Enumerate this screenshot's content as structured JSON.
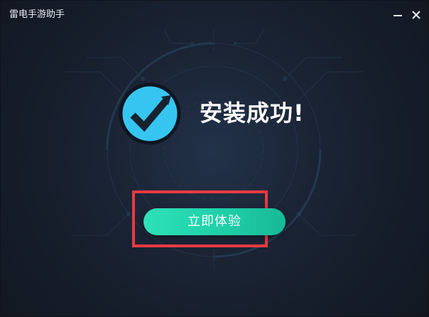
{
  "window": {
    "title": "雷电手游助手",
    "minimize_icon": "minimize-icon",
    "close_icon": "close-icon"
  },
  "status": {
    "icon": "check-circle-icon",
    "message": "安装成功!"
  },
  "actions": {
    "primary_button_label": "立即体验"
  },
  "colors": {
    "background": "#1a2332",
    "accent_teal": "#22d3ae",
    "check_circle": "#36c5f0",
    "highlight_border": "#ea3a42",
    "title_text": "#ffffff"
  }
}
